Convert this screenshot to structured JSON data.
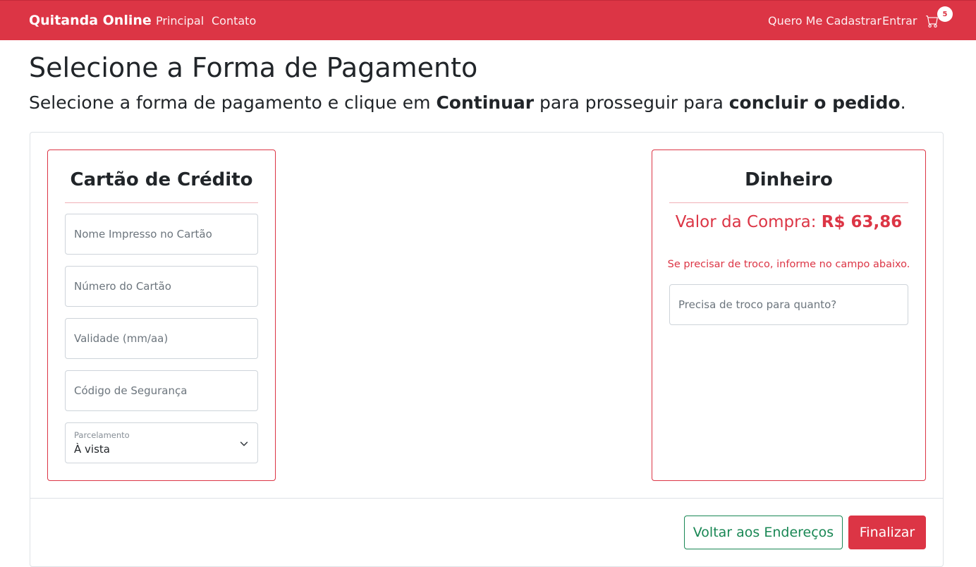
{
  "nav": {
    "brand": "Quitanda Online",
    "links": [
      "Principal",
      "Contato"
    ],
    "register": "Quero Me Cadastrar",
    "login": "Entrar",
    "cart_count": "5",
    "cart_icon": "cart-icon"
  },
  "header": {
    "title": "Selecione a Forma de Pagamento",
    "subtitle_part1": "Selecione a forma de pagamento e clique em ",
    "subtitle_bold1": "Continuar",
    "subtitle_part2": " para prosseguir para ",
    "subtitle_bold2": "concluir o pedido",
    "subtitle_part3": "."
  },
  "credit_card": {
    "title": "Cartão de Crédito",
    "name_placeholder": "Nome Impresso no Cartão",
    "number_placeholder": "Número do Cartão",
    "expiry_placeholder": "Validade (mm/aa)",
    "cvv_placeholder": "Código de Segurança",
    "installments_label": "Parcelamento",
    "installments_value": "À vista"
  },
  "cash": {
    "title": "Dinheiro",
    "amount_label": "Valor da Compra: ",
    "amount_value": "R$ 63,86",
    "change_hint": "Se precisar de troco, informe no campo abaixo.",
    "change_placeholder": "Precisa de troco para quanto?"
  },
  "actions": {
    "back": "Voltar aos Endereços",
    "finish": "Finalizar"
  },
  "colors": {
    "primary": "#dc3545",
    "success": "#198754"
  }
}
